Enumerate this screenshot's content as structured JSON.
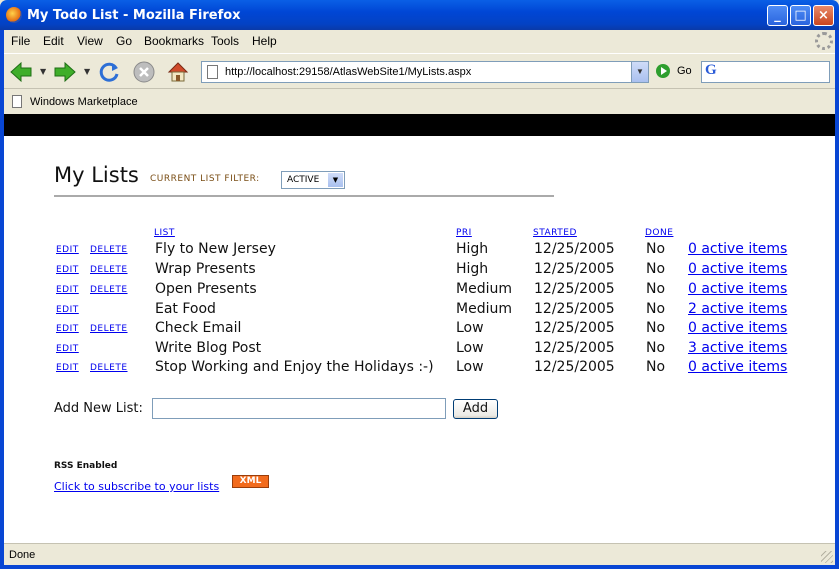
{
  "window": {
    "title": "My Todo List - Mozilla Firefox",
    "buttons": {
      "minimize": "_",
      "maximize": "□",
      "close": "×"
    }
  },
  "menubar": {
    "items": [
      "File",
      "Edit",
      "View",
      "Go",
      "Bookmarks",
      "Tools",
      "Help"
    ]
  },
  "navbar": {
    "url": "http://localhost:29158/AtlasWebSite1/MyLists.aspx",
    "go_label": "Go",
    "icons": [
      "back-arrow-icon",
      "forward-arrow-icon",
      "reload-icon",
      "stop-icon",
      "home-icon"
    ]
  },
  "bookmarks": {
    "items": [
      "Windows Marketplace"
    ]
  },
  "page": {
    "heading": "My Lists",
    "filter_label": "CURRENT LIST FILTER:",
    "filter_value": "ACTIVE",
    "columns": {
      "list": "LIST",
      "pri": "PRI",
      "started": "STARTED",
      "done": "DONE"
    },
    "edit_label": "EDIT",
    "delete_label": "DELETE",
    "rows": [
      {
        "name": "Fly to New Jersey",
        "pri": "High",
        "started": "12/25/2005",
        "done": "No",
        "items": "0 active items",
        "delete": true
      },
      {
        "name": "Wrap Presents",
        "pri": "High",
        "started": "12/25/2005",
        "done": "No",
        "items": "0 active items",
        "delete": true
      },
      {
        "name": "Open Presents",
        "pri": "Medium",
        "started": "12/25/2005",
        "done": "No",
        "items": "0 active items",
        "delete": true
      },
      {
        "name": "Eat Food",
        "pri": "Medium",
        "started": "12/25/2005",
        "done": "No",
        "items": "2 active items",
        "delete": false
      },
      {
        "name": "Check Email",
        "pri": "Low",
        "started": "12/25/2005",
        "done": "No",
        "items": "0 active items",
        "delete": true
      },
      {
        "name": "Write Blog Post",
        "pri": "Low",
        "started": "12/25/2005",
        "done": "No",
        "items": "3 active items",
        "delete": false
      },
      {
        "name": "Stop Working and Enjoy the Holidays :-)",
        "pri": "Low",
        "started": "12/25/2005",
        "done": "No",
        "items": "0 active items",
        "delete": true
      }
    ],
    "add_label": "Add New List:",
    "add_value": "",
    "add_button": "Add",
    "rss_label": "RSS Enabled",
    "subscribe_link": "Click to subscribe to your lists",
    "xml_badge": "XML"
  },
  "status": {
    "text": "Done"
  },
  "colors": {
    "titlebar": "#0046d5",
    "link": "#0000ee",
    "filter_label": "#7a4e16",
    "xml_badge": "#f26b1d",
    "chrome": "#ece9d8"
  }
}
